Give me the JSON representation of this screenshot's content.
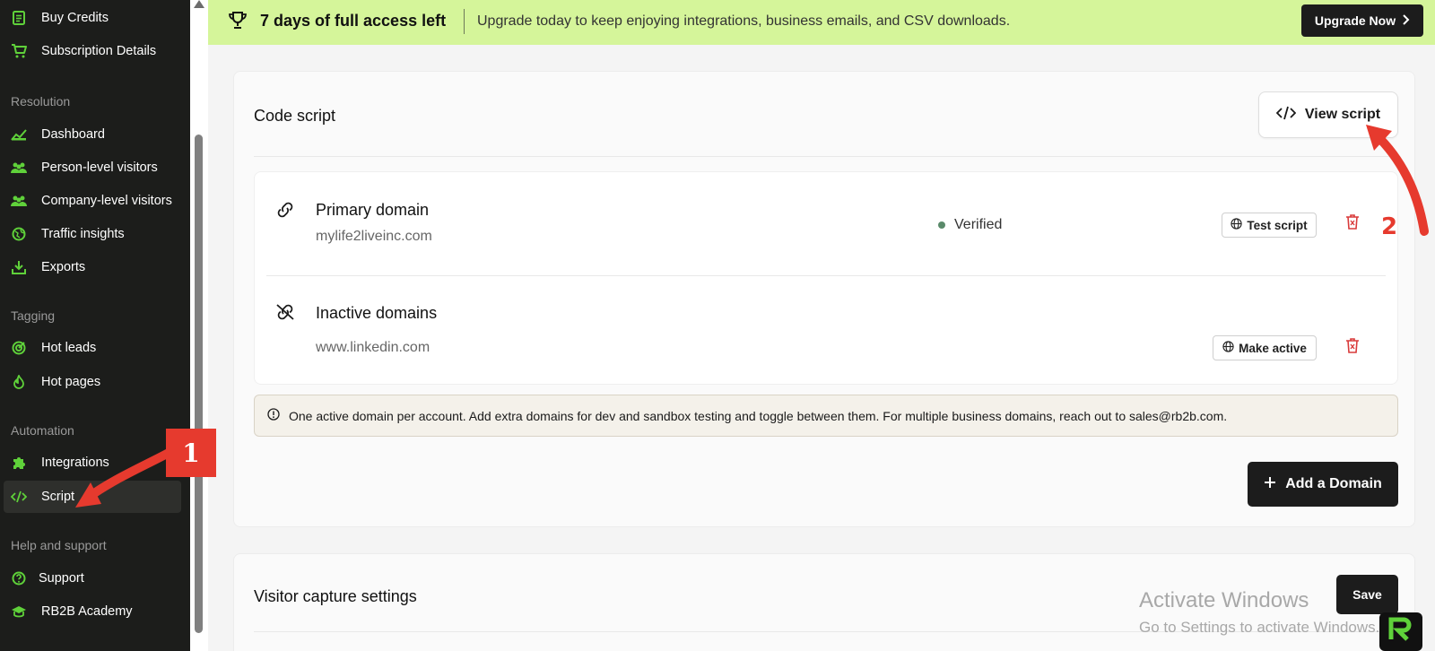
{
  "sidebar": {
    "items": [
      {
        "label": "Buy Credits",
        "icon": "receipt-icon"
      },
      {
        "label": "Subscription Details",
        "icon": "cart-icon"
      },
      {
        "label": "Dashboard",
        "icon": "chart-icon"
      },
      {
        "label": "Person-level visitors",
        "icon": "people-icon"
      },
      {
        "label": "Company-level visitors",
        "icon": "people-icon"
      },
      {
        "label": "Traffic insights",
        "icon": "globe-icon"
      },
      {
        "label": "Exports",
        "icon": "download-icon"
      },
      {
        "label": "Hot leads",
        "icon": "target-icon"
      },
      {
        "label": "Hot pages",
        "icon": "flame-icon"
      },
      {
        "label": "Integrations",
        "icon": "puzzle-icon"
      },
      {
        "label": "Script",
        "icon": "code-icon"
      },
      {
        "label": "Support",
        "icon": "help-icon"
      },
      {
        "label": "RB2B Academy",
        "icon": "graduation-cap-icon"
      }
    ],
    "sections": [
      "Resolution",
      "Tagging",
      "Automation",
      "Help and support"
    ],
    "active_item": "Script",
    "accent": "#5fd13a"
  },
  "banner": {
    "title": "7 days of full access left",
    "message": "Upgrade today to keep enjoying integrations, business emails, and CSV downloads.",
    "cta": "Upgrade Now",
    "background": "#d5f59a"
  },
  "code_script": {
    "title": "Code script",
    "view_button": "View script",
    "primary": {
      "label": "Primary domain",
      "domain": "mylife2liveinc.com",
      "status": "Verified",
      "button": "Test script"
    },
    "inactive": {
      "label": "Inactive domains",
      "domain": "www.linkedin.com",
      "button": "Make active"
    },
    "info": "One active domain per account. Add extra domains for dev and sandbox testing and toggle between them. For multiple business domains, reach out to sales@rb2b.com.",
    "add_button": "Add a Domain"
  },
  "visitor_capture": {
    "title": "Visitor capture settings",
    "save_button": "Save"
  },
  "annotations": {
    "step1": "1",
    "step2": "2",
    "color": "#e63a2e"
  },
  "watermark": {
    "line1": "Activate Windows",
    "line2": "Go to Settings to activate Windows."
  }
}
